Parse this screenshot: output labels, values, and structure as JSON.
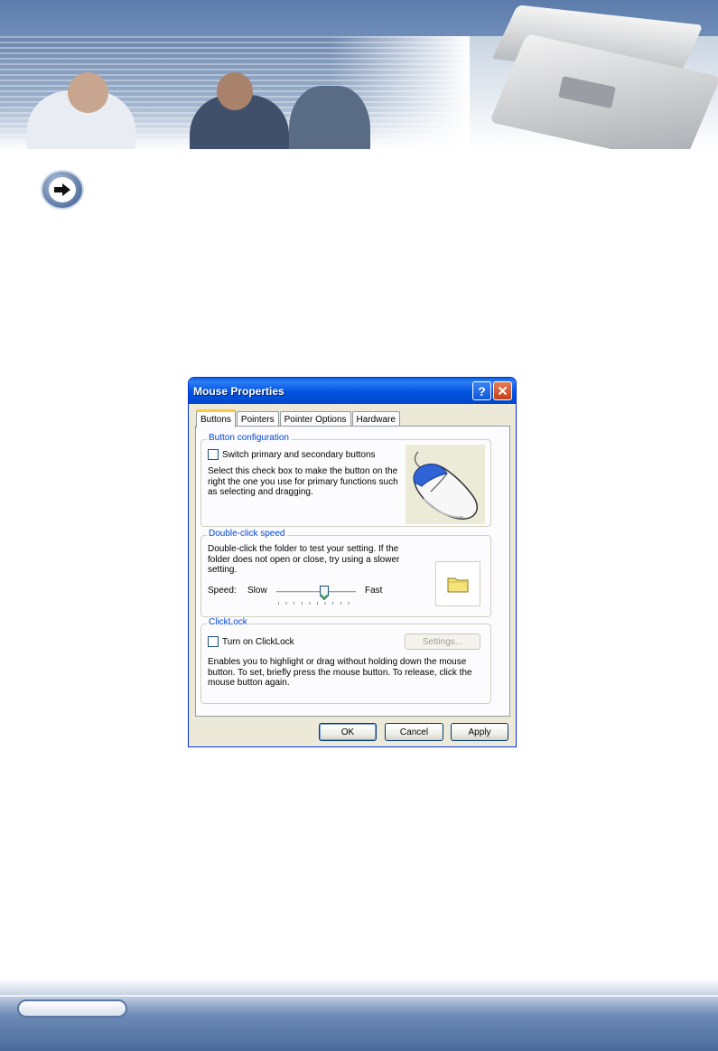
{
  "dialog": {
    "title": "Mouse Properties",
    "tabs": [
      {
        "label": "Buttons",
        "active": true
      },
      {
        "label": "Pointers",
        "active": false
      },
      {
        "label": "Pointer Options",
        "active": false
      },
      {
        "label": "Hardware",
        "active": false
      }
    ],
    "button_configuration": {
      "title": "Button configuration",
      "checkbox_label": "Switch primary and secondary buttons",
      "checked": false,
      "description_lines": [
        "Select this check box to make the button on the",
        "right the one you use for primary functions such",
        "as selecting and dragging."
      ]
    },
    "double_click": {
      "title": "Double-click speed",
      "description_lines": [
        "Double-click the folder to test your setting. If the",
        "folder does not open or close, try using a slower",
        "setting."
      ],
      "speed_label": "Speed:",
      "slow_label": "Slow",
      "fast_label": "Fast",
      "slider_value_fraction": 0.6
    },
    "clicklock": {
      "title": "ClickLock",
      "checkbox_label": "Turn on ClickLock",
      "checked": false,
      "settings_button": "Settings...",
      "description_lines": [
        "Enables you to highlight or drag without holding down the mouse",
        "button. To set, briefly press the mouse button. To release, click the",
        "mouse button again."
      ]
    },
    "buttons": {
      "ok": "OK",
      "cancel": "Cancel",
      "apply": "Apply"
    }
  },
  "colors": {
    "titlebar": "#0053e1",
    "group_title": "#0046d5",
    "banner_blue": "#5c7cab",
    "active_tab_accent": "#ffc73c"
  }
}
